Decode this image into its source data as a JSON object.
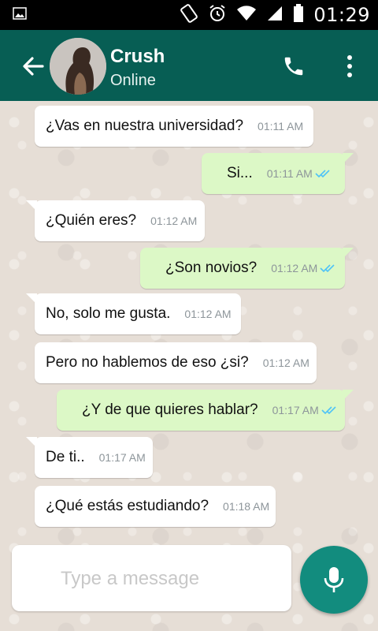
{
  "status_bar": {
    "time": "01:29"
  },
  "header": {
    "contact_name": "Crush",
    "contact_status": "Online"
  },
  "messages": [
    {
      "direction": "in",
      "text": "¿Vas en nuestra universidad?",
      "time": "01:11 AM"
    },
    {
      "direction": "out",
      "text": "Si...",
      "time": "01:11 AM",
      "status": "read"
    },
    {
      "direction": "in",
      "text": "¿Quién eres?",
      "time": "01:12 AM"
    },
    {
      "direction": "out",
      "text": "¿Son novios?",
      "time": "01:12 AM",
      "status": "read"
    },
    {
      "direction": "in",
      "text": "No, solo me gusta.",
      "time": "01:12 AM"
    },
    {
      "direction": "in",
      "text": "Pero no hablemos de eso ¿si?",
      "time": "01:12 AM"
    },
    {
      "direction": "out",
      "text": "¿Y de que quieres hablar?",
      "time": "01:17 AM",
      "status": "read"
    },
    {
      "direction": "in",
      "text": "De ti..",
      "time": "01:17 AM"
    },
    {
      "direction": "in",
      "text": "¿Qué estás estudiando?",
      "time": "01:18 AM"
    }
  ],
  "composer": {
    "placeholder": "Type a message",
    "value": ""
  },
  "colors": {
    "header": "#075e54",
    "outgoing_bubble": "#dcf8c6",
    "incoming_bubble": "#ffffff",
    "read_ticks": "#4fc3f7",
    "mic_button": "#128c7e"
  }
}
